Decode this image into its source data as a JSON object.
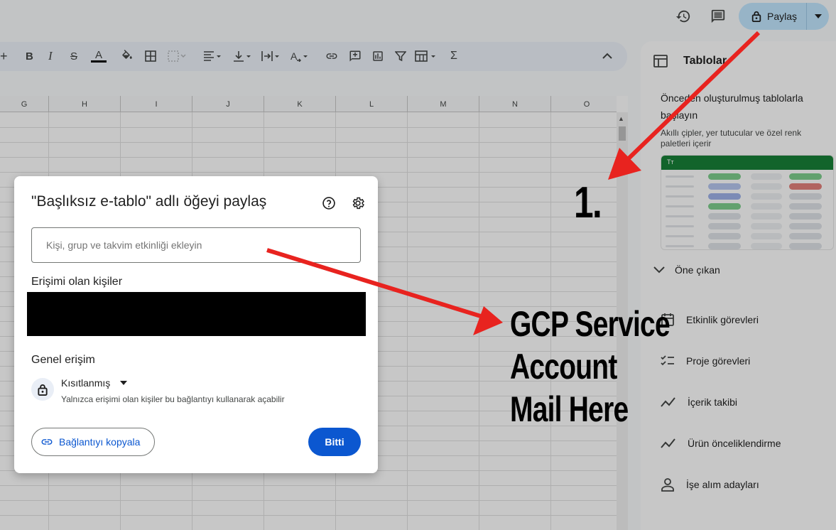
{
  "topbar": {
    "share_label": "Paylaş",
    "icons": [
      "history-icon",
      "comment-icon",
      "lock-icon",
      "caret-down-icon"
    ]
  },
  "toolbar": {
    "tools": [
      "plus-icon",
      "bold",
      "italic",
      "strikethrough",
      "text-color",
      "fill-color",
      "borders",
      "merge-cells",
      "align-horizontal",
      "align-vertical",
      "text-wrap",
      "text-rotate",
      "insert-link",
      "insert-comment",
      "insert-chart",
      "filter",
      "table-view",
      "functions",
      "collapse"
    ],
    "bold_label": "B",
    "italic_label": "I",
    "strike_label": "S",
    "textcolor_label": "A",
    "functions_label": "Σ",
    "collapse_label": "^"
  },
  "grid": {
    "columns": [
      "G",
      "H",
      "I",
      "J",
      "K",
      "L",
      "M",
      "N",
      "O"
    ]
  },
  "sidepanel": {
    "title": "Tablolar",
    "heading": "Önceden oluşturulmuş tablolarla başlayın",
    "subtext": "Akıllı çipler, yer tutucular ve özel renk paletleri içerir",
    "preview_header": "Tт",
    "section_label": "Öne çıkan",
    "items": [
      {
        "label": "Etkinlik görevleri",
        "icon": "calendar-icon"
      },
      {
        "label": "Proje görevleri",
        "icon": "checklist-icon"
      },
      {
        "label": "İçerik takibi",
        "icon": "trend-icon"
      },
      {
        "label": "Ürün önceliklendirme",
        "icon": "trend-icon"
      },
      {
        "label": "İşe alım adayları",
        "icon": "person-icon"
      }
    ]
  },
  "dialog": {
    "title": "\"Başlıksız e-tablo\" adlı öğeyi paylaş",
    "add_placeholder": "Kişi, grup ve takvim etkinliği ekleyin",
    "people_label": "Erişimi olan kişiler",
    "general_access_label": "Genel erişim",
    "access_level": "Kısıtlanmış",
    "access_description": "Yalnızca erişimi olan kişiler bu bağlantıyı kullanarak açabilir",
    "copy_link_label": "Bağlantıyı kopyala",
    "done_label": "Bitti"
  },
  "annotations": {
    "step_number": "1.",
    "note_line1": "GCP Service",
    "note_line2": "Account",
    "note_line3": "Mail Here",
    "arrow_color": "#e8231f"
  },
  "colors": {
    "primary": "#0b57d0",
    "share_bg": "#c2e7ff",
    "preview_header": "#188038"
  }
}
